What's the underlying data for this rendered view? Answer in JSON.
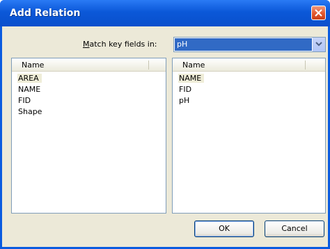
{
  "window": {
    "title": "Add Relation"
  },
  "match": {
    "label_prefix": "",
    "label_mnemonic": "M",
    "label_rest": "atch key fields in:",
    "selected_value": "pH"
  },
  "left_list": {
    "header": "Name",
    "items": [
      "AREA",
      "NAME",
      "FID",
      "Shape"
    ],
    "selected": "AREA"
  },
  "right_list": {
    "header": "Name",
    "items": [
      "NAME",
      "FID",
      "pH"
    ],
    "selected": "NAME"
  },
  "buttons": {
    "ok": "OK",
    "cancel": "Cancel"
  },
  "colors": {
    "title_bar": "#0b58d8",
    "selection": "#316ac5",
    "dialog_bg": "#ece9d8"
  }
}
